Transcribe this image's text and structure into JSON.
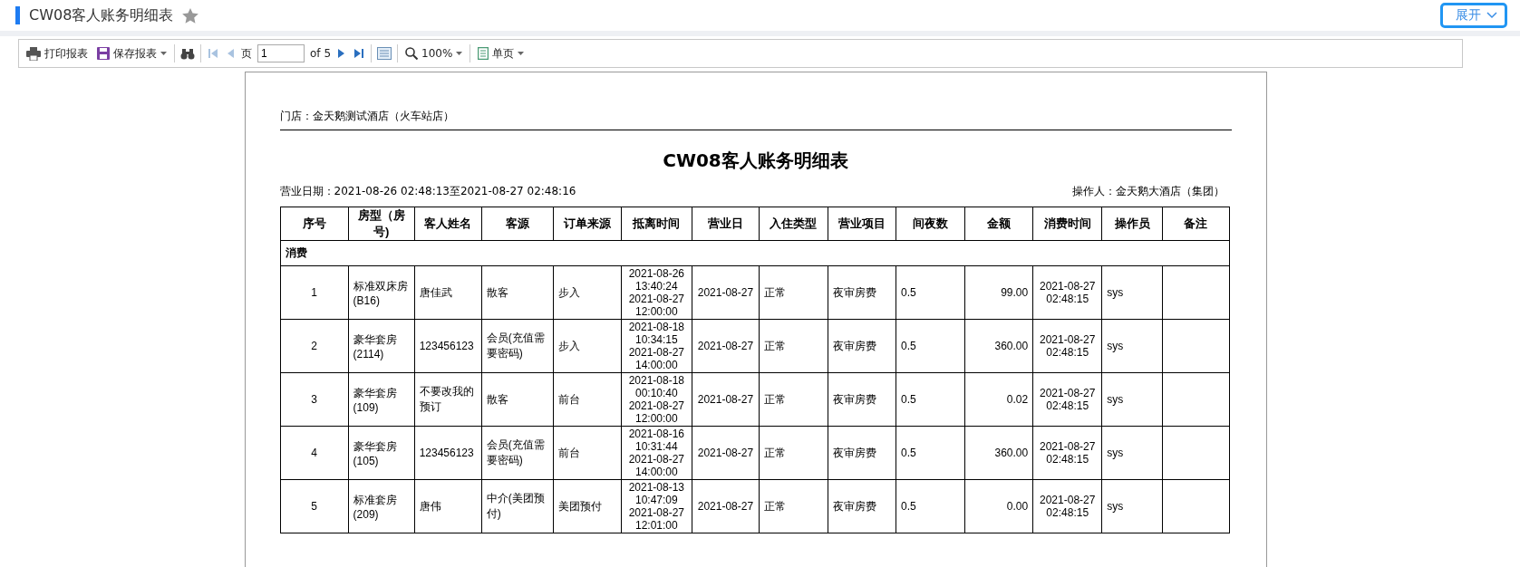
{
  "header": {
    "title": "CW08客人账务明细表",
    "expand_button": "展开"
  },
  "toolbar": {
    "print": "打印报表",
    "save": "保存报表",
    "nav": [
      {
        "kind": "first",
        "disabled": true
      },
      {
        "kind": "prev",
        "disabled": true
      }
    ],
    "page_label": "页",
    "page_value": "1",
    "page_total": "of 5",
    "nav_after": [
      {
        "kind": "next",
        "disabled": false
      },
      {
        "kind": "last",
        "disabled": false
      }
    ],
    "zoom": "100%",
    "view": "单页"
  },
  "report": {
    "store": "门店：金天鹅测试酒店（火车站店）",
    "title": "CW08客人账务明细表",
    "date_range": "营业日期：2021-08-26 02:48:13至2021-08-27 02:48:16",
    "operator": "操作人：金天鹅大酒店（集团）",
    "columns": [
      "序号",
      "房型（房号)",
      "客人姓名",
      "客源",
      "订单来源",
      "抵离时间",
      "营业日",
      "入住类型",
      "营业项目",
      "间夜数",
      "金额",
      "消费时间",
      "操作员",
      "备注"
    ],
    "group": "消费",
    "rows": [
      [
        "1",
        "标准双床房(B16)",
        "唐佳武",
        "散客",
        "步入",
        "2021-08-26 13:40:24 2021-08-27 12:00:00",
        "2021-08-27",
        "正常",
        "夜审房费",
        "0.5",
        "99.00",
        "2021-08-27 02:48:15",
        "sys"
      ],
      [
        "2",
        "豪华套房(2114)",
        "123456123",
        "会员(充值需要密码)",
        "步入",
        "2021-08-18 10:34:15 2021-08-27 14:00:00",
        "2021-08-27",
        "正常",
        "夜审房费",
        "0.5",
        "360.00",
        "2021-08-27 02:48:15",
        "sys"
      ],
      [
        "3",
        "豪华套房(109)",
        "不要改我的预订",
        "散客",
        "前台",
        "2021-08-18 00:10:40 2021-08-27 12:00:00",
        "2021-08-27",
        "正常",
        "夜审房费",
        "0.5",
        "0.02",
        "2021-08-27 02:48:15",
        "sys"
      ],
      [
        "4",
        "豪华套房(105)",
        "123456123",
        "会员(充值需要密码)",
        "前台",
        "2021-08-16 10:31:44 2021-08-27 14:00:00",
        "2021-08-27",
        "正常",
        "夜审房费",
        "0.5",
        "360.00",
        "2021-08-27 02:48:15",
        "sys"
      ],
      [
        "5",
        "标准套房(209)",
        "唐伟",
        "中介(美团预付)",
        "美团预付",
        "2021-08-13 10:47:09 2021-08-27 12:01:00",
        "2021-08-27",
        "正常",
        "夜审房费",
        "0.5",
        "0.00",
        "2021-08-27 02:48:15",
        "sys"
      ]
    ]
  }
}
